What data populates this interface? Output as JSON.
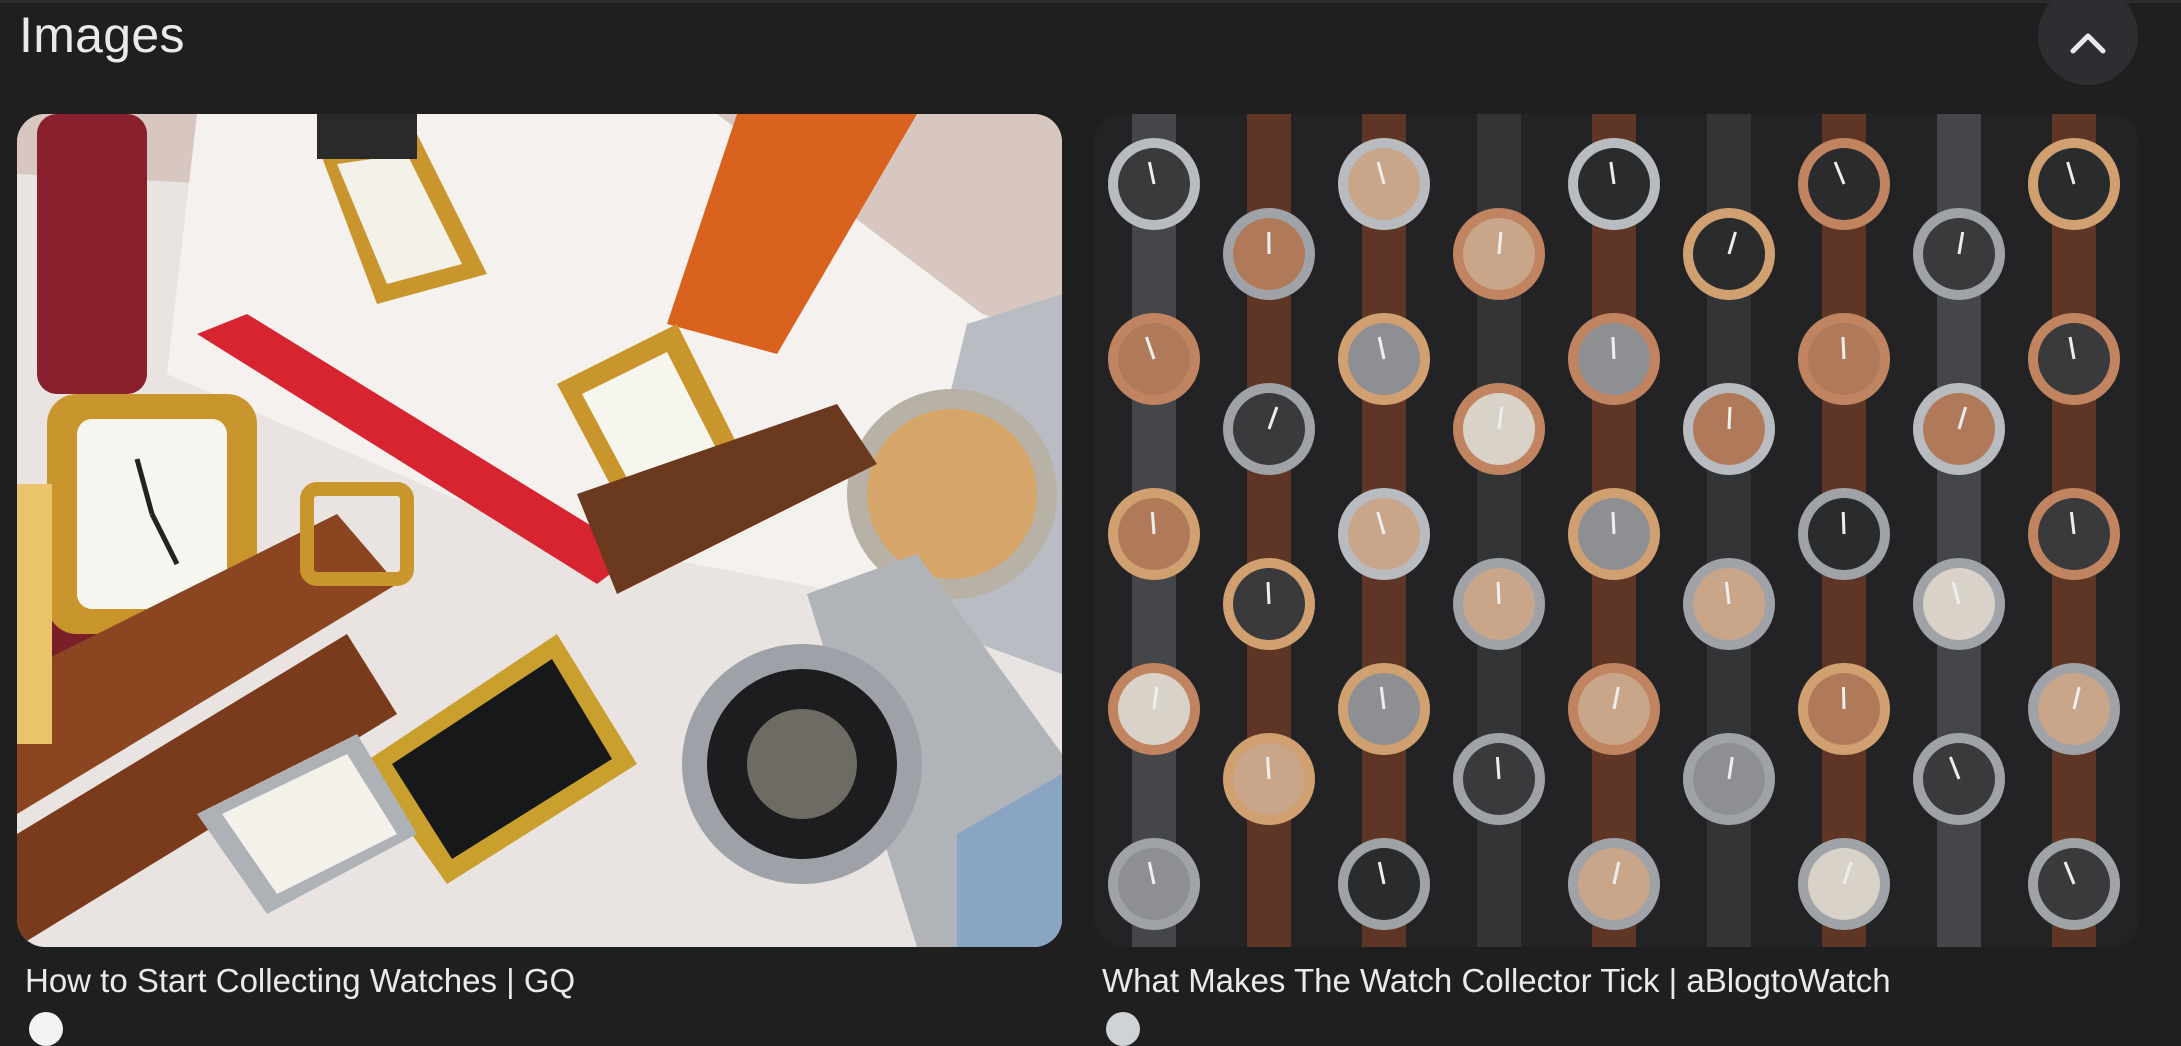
{
  "section": {
    "title": "Images",
    "collapse_icon": "chevron-up-icon"
  },
  "results": [
    {
      "caption": "How to Start Collecting Watches | GQ",
      "thumbnail": "watches-on-white-box",
      "favicon": "site-favicon"
    },
    {
      "caption": "What Makes The Watch Collector Tick | aBlogtoWatch",
      "thumbnail": "watches-on-black-fabric",
      "favicon": "site-favicon"
    }
  ],
  "colors": {
    "background": "#1f1f1f",
    "button_bg": "#2d2e31",
    "text": "#e8eaed"
  }
}
